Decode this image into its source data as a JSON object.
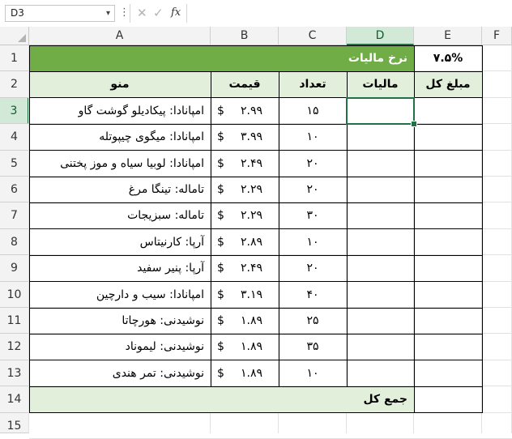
{
  "formula_bar": {
    "name_box": "D3",
    "dropdown_icon": "chevron-down-icon",
    "cancel_icon": "x-icon",
    "enter_icon": "check-icon",
    "fx_label": "fx",
    "formula": ""
  },
  "columns": [
    "A",
    "B",
    "C",
    "D",
    "E",
    "F"
  ],
  "rows": [
    "1",
    "2",
    "3",
    "4",
    "5",
    "6",
    "7",
    "8",
    "9",
    "10",
    "11",
    "12",
    "13",
    "14",
    "15"
  ],
  "selected_cell": "D3",
  "colors": {
    "header_green": "#70ad47",
    "light_green": "#e2efda",
    "selection": "#217346"
  },
  "sheet": {
    "tax_rate_label": "نرخ مالیات",
    "tax_rate_value": "۷.۵%",
    "headers": {
      "menu": "منو",
      "price": "قیمت",
      "quantity": "تعداد",
      "tax": "مالیات",
      "total": "مبلغ کل"
    },
    "currency": "$",
    "items": [
      {
        "menu": "امپانادا: پیکادیلو گوشت گاو",
        "price": "۲.۹۹",
        "qty": "۱۵"
      },
      {
        "menu": "امپانادا: میگوی چیپوتله",
        "price": "۳.۹۹",
        "qty": "۱۰"
      },
      {
        "menu": "امپانادا: لوبیا سیاه و موز پختنی",
        "price": "۲.۴۹",
        "qty": "۲۰"
      },
      {
        "menu": "تاماله: تینگا مرغ",
        "price": "۲.۲۹",
        "qty": "۲۰"
      },
      {
        "menu": "تاماله: سبزیجات",
        "price": "۲.۲۹",
        "qty": "۳۰"
      },
      {
        "menu": "آرپا: کارنیتاس",
        "price": "۲.۸۹",
        "qty": "۱۰"
      },
      {
        "menu": "آرپا: پنیر سفید",
        "price": "۲.۴۹",
        "qty": "۲۰"
      },
      {
        "menu": "امپانادا: سیب و دارچین",
        "price": "۳.۱۹",
        "qty": "۴۰"
      },
      {
        "menu": "نوشیدنی: هورچاتا",
        "price": "۱.۸۹",
        "qty": "۲۵"
      },
      {
        "menu": "نوشیدنی: لیموناد",
        "price": "۱.۸۹",
        "qty": "۳۵"
      },
      {
        "menu": "نوشیدنی: تمر هندی",
        "price": "۱.۸۹",
        "qty": "۱۰"
      }
    ],
    "grand_total_label": "جمع کل"
  }
}
